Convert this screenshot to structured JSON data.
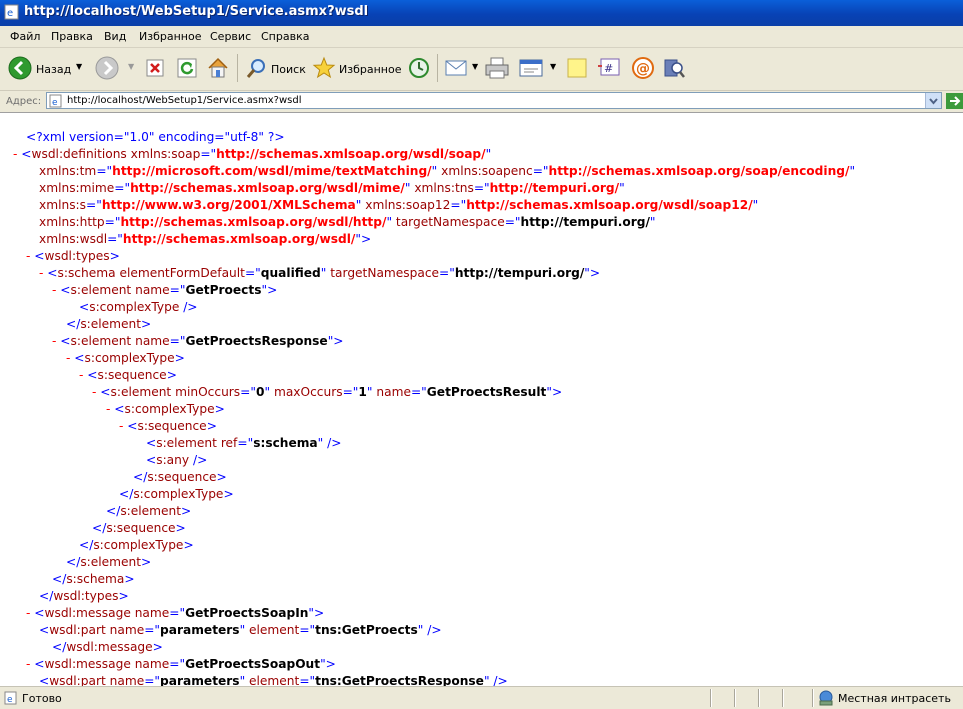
{
  "window": {
    "title": "http://localhost/WebSetup1/Service.asmx?wsdl"
  },
  "menu": [
    "Файл",
    "Правка",
    "Вид",
    "Избранное",
    "Сервис",
    "Справка"
  ],
  "toolbar": {
    "back_label": "Назад",
    "search_label": "Поиск",
    "favorites_label": "Избранное"
  },
  "address": {
    "label": "Адрес:",
    "url": "http://localhost/WebSetup1/Service.asmx?wsdl"
  },
  "status": {
    "text": "Готово",
    "zone": "Местная интрасеть"
  },
  "xml_lines": [
    [
      [
        "b",
        "<?xml version=\"1.0\" encoding=\"utf-8\" ?>"
      ]
    ],
    [
      [
        "m",
        "- "
      ],
      [
        "b",
        "<"
      ],
      [
        "t",
        "wsdl:definitions "
      ],
      [
        "an",
        "xmlns:soap"
      ],
      [
        "b",
        "=\""
      ],
      [
        "cv",
        "http://schemas.xmlsoap.org/wsdl/soap/"
      ],
      [
        "b",
        "\""
      ]
    ],
    [
      [
        "an",
        "xmlns:tm"
      ],
      [
        "b",
        "=\""
      ],
      [
        "cv",
        "http://microsoft.com/wsdl/mime/textMatching/"
      ],
      [
        "b",
        "\" "
      ],
      [
        "an",
        "xmlns:soapenc"
      ],
      [
        "b",
        "=\""
      ],
      [
        "cv",
        "http://schemas.xmlsoap.org/soap/encoding/"
      ],
      [
        "b",
        "\""
      ]
    ],
    [
      [
        "an",
        "xmlns:mime"
      ],
      [
        "b",
        "=\""
      ],
      [
        "cv",
        "http://schemas.xmlsoap.org/wsdl/mime/"
      ],
      [
        "b",
        "\" "
      ],
      [
        "an",
        "xmlns:tns"
      ],
      [
        "b",
        "=\""
      ],
      [
        "cv",
        "http://tempuri.org/"
      ],
      [
        "b",
        "\""
      ]
    ],
    [
      [
        "an",
        "xmlns:s"
      ],
      [
        "b",
        "=\""
      ],
      [
        "cv",
        "http://www.w3.org/2001/XMLSchema"
      ],
      [
        "b",
        "\" "
      ],
      [
        "an",
        "xmlns:soap12"
      ],
      [
        "b",
        "=\""
      ],
      [
        "cv",
        "http://schemas.xmlsoap.org/wsdl/soap12/"
      ],
      [
        "b",
        "\""
      ]
    ],
    [
      [
        "an",
        "xmlns:http"
      ],
      [
        "b",
        "=\""
      ],
      [
        "cv",
        "http://schemas.xmlsoap.org/wsdl/http/"
      ],
      [
        "b",
        "\" "
      ],
      [
        "an",
        "targetNamespace"
      ],
      [
        "b",
        "=\""
      ],
      [
        "v",
        "http://tempuri.org/"
      ],
      [
        "b",
        "\""
      ]
    ],
    [
      [
        "an",
        "xmlns:wsdl"
      ],
      [
        "b",
        "=\""
      ],
      [
        "cv",
        "http://schemas.xmlsoap.org/wsdl/"
      ],
      [
        "b",
        "\">"
      ]
    ],
    [
      [
        "m",
        "- "
      ],
      [
        "b",
        "<"
      ],
      [
        "t",
        "wsdl:types"
      ],
      [
        "b",
        ">"
      ]
    ],
    [
      [
        "m",
        "- "
      ],
      [
        "b",
        "<"
      ],
      [
        "t",
        "s:schema "
      ],
      [
        "an",
        "elementFormDefault"
      ],
      [
        "b",
        "=\""
      ],
      [
        "v",
        "qualified"
      ],
      [
        "b",
        "\" "
      ],
      [
        "an",
        "targetNamespace"
      ],
      [
        "b",
        "=\""
      ],
      [
        "v",
        "http://tempuri.org/"
      ],
      [
        "b",
        "\">"
      ]
    ],
    [
      [
        "m",
        "- "
      ],
      [
        "b",
        "<"
      ],
      [
        "t",
        "s:element "
      ],
      [
        "an",
        "name"
      ],
      [
        "b",
        "=\""
      ],
      [
        "v",
        "GetProects"
      ],
      [
        "b",
        "\">"
      ]
    ],
    [
      [
        "b",
        "<"
      ],
      [
        "t",
        "s:complexType "
      ],
      [
        "b",
        "/>"
      ]
    ],
    [
      [
        "b",
        "</"
      ],
      [
        "t",
        "s:element"
      ],
      [
        "b",
        ">"
      ]
    ],
    [
      [
        "m",
        "- "
      ],
      [
        "b",
        "<"
      ],
      [
        "t",
        "s:element "
      ],
      [
        "an",
        "name"
      ],
      [
        "b",
        "=\""
      ],
      [
        "v",
        "GetProectsResponse"
      ],
      [
        "b",
        "\">"
      ]
    ],
    [
      [
        "m",
        "- "
      ],
      [
        "b",
        "<"
      ],
      [
        "t",
        "s:complexType"
      ],
      [
        "b",
        ">"
      ]
    ],
    [
      [
        "m",
        "- "
      ],
      [
        "b",
        "<"
      ],
      [
        "t",
        "s:sequence"
      ],
      [
        "b",
        ">"
      ]
    ],
    [
      [
        "m",
        "- "
      ],
      [
        "b",
        "<"
      ],
      [
        "t",
        "s:element "
      ],
      [
        "an",
        "minOccurs"
      ],
      [
        "b",
        "=\""
      ],
      [
        "v",
        "0"
      ],
      [
        "b",
        "\" "
      ],
      [
        "an",
        "maxOccurs"
      ],
      [
        "b",
        "=\""
      ],
      [
        "v",
        "1"
      ],
      [
        "b",
        "\" "
      ],
      [
        "an",
        "name"
      ],
      [
        "b",
        "=\""
      ],
      [
        "v",
        "GetProectsResult"
      ],
      [
        "b",
        "\">"
      ]
    ],
    [
      [
        "m",
        "- "
      ],
      [
        "b",
        "<"
      ],
      [
        "t",
        "s:complexType"
      ],
      [
        "b",
        ">"
      ]
    ],
    [
      [
        "m",
        "- "
      ],
      [
        "b",
        "<"
      ],
      [
        "t",
        "s:sequence"
      ],
      [
        "b",
        ">"
      ]
    ],
    [
      [
        "b",
        "<"
      ],
      [
        "t",
        "s:element "
      ],
      [
        "an",
        "ref"
      ],
      [
        "b",
        "=\""
      ],
      [
        "v",
        "s:schema"
      ],
      [
        "b",
        "\" />"
      ]
    ],
    [
      [
        "b",
        "<"
      ],
      [
        "t",
        "s:any "
      ],
      [
        "b",
        "/>"
      ]
    ],
    [
      [
        "b",
        "</"
      ],
      [
        "t",
        "s:sequence"
      ],
      [
        "b",
        ">"
      ]
    ],
    [
      [
        "b",
        "</"
      ],
      [
        "t",
        "s:complexType"
      ],
      [
        "b",
        ">"
      ]
    ],
    [
      [
        "b",
        "</"
      ],
      [
        "t",
        "s:element"
      ],
      [
        "b",
        ">"
      ]
    ],
    [
      [
        "b",
        "</"
      ],
      [
        "t",
        "s:sequence"
      ],
      [
        "b",
        ">"
      ]
    ],
    [
      [
        "b",
        "</"
      ],
      [
        "t",
        "s:complexType"
      ],
      [
        "b",
        ">"
      ]
    ],
    [
      [
        "b",
        "</"
      ],
      [
        "t",
        "s:element"
      ],
      [
        "b",
        ">"
      ]
    ],
    [
      [
        "b",
        "</"
      ],
      [
        "t",
        "s:schema"
      ],
      [
        "b",
        ">"
      ]
    ],
    [
      [
        "b",
        "</"
      ],
      [
        "t",
        "wsdl:types"
      ],
      [
        "b",
        ">"
      ]
    ],
    [
      [
        "m",
        "- "
      ],
      [
        "b",
        "<"
      ],
      [
        "t",
        "wsdl:message "
      ],
      [
        "an",
        "name"
      ],
      [
        "b",
        "=\""
      ],
      [
        "v",
        "GetProectsSoapIn"
      ],
      [
        "b",
        "\">"
      ]
    ],
    [
      [
        "b",
        "<"
      ],
      [
        "t",
        "wsdl:part "
      ],
      [
        "an",
        "name"
      ],
      [
        "b",
        "=\""
      ],
      [
        "v",
        "parameters"
      ],
      [
        "b",
        "\" "
      ],
      [
        "an",
        "element"
      ],
      [
        "b",
        "=\""
      ],
      [
        "v",
        "tns:GetProects"
      ],
      [
        "b",
        "\" />"
      ]
    ],
    [
      [
        "b",
        "</"
      ],
      [
        "t",
        "wsdl:message"
      ],
      [
        "b",
        ">"
      ]
    ],
    [
      [
        "m",
        "- "
      ],
      [
        "b",
        "<"
      ],
      [
        "t",
        "wsdl:message "
      ],
      [
        "an",
        "name"
      ],
      [
        "b",
        "=\""
      ],
      [
        "v",
        "GetProectsSoapOut"
      ],
      [
        "b",
        "\">"
      ]
    ],
    [
      [
        "b",
        "<"
      ],
      [
        "t",
        "wsdl:part "
      ],
      [
        "an",
        "name"
      ],
      [
        "b",
        "=\""
      ],
      [
        "v",
        "parameters"
      ],
      [
        "b",
        "\" "
      ],
      [
        "an",
        "element"
      ],
      [
        "b",
        "=\""
      ],
      [
        "v",
        "tns:GetProectsResponse"
      ],
      [
        "b",
        "\" />"
      ]
    ]
  ]
}
